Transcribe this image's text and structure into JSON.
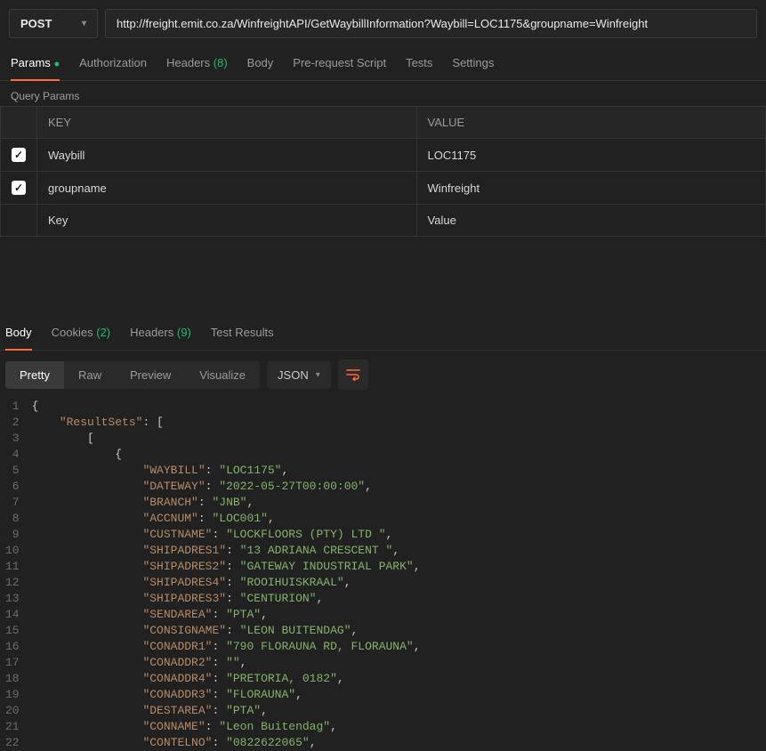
{
  "request": {
    "method": "POST",
    "url": "http://freight.emit.co.za/WinfreightAPI/GetWaybillInformation?Waybill=LOC1175&groupname=Winfreight"
  },
  "tabs": {
    "params": "Params",
    "authorization": "Authorization",
    "headers": "Headers",
    "headers_count": "(8)",
    "body": "Body",
    "prerequest": "Pre-request Script",
    "tests": "Tests",
    "settings": "Settings"
  },
  "query_params": {
    "section_title": "Query Params",
    "key_header": "KEY",
    "value_header": "VALUE",
    "rows": [
      {
        "key": "Waybill",
        "value": "LOC1175"
      },
      {
        "key": "groupname",
        "value": "Winfreight"
      }
    ],
    "placeholder_key": "Key",
    "placeholder_value": "Value"
  },
  "response_tabs": {
    "body": "Body",
    "cookies": "Cookies",
    "cookies_count": "(2)",
    "headers": "Headers",
    "headers_count": "(9)",
    "test_results": "Test Results"
  },
  "viewmodes": {
    "pretty": "Pretty",
    "raw": "Raw",
    "preview": "Preview",
    "visualize": "Visualize",
    "format": "JSON"
  },
  "code_lines": [
    {
      "n": 1,
      "indent": 0,
      "type": "brace",
      "text": "{"
    },
    {
      "n": 2,
      "indent": 1,
      "type": "kv_open",
      "key": "ResultSets",
      "after": ": ["
    },
    {
      "n": 3,
      "indent": 2,
      "type": "brace",
      "text": "["
    },
    {
      "n": 4,
      "indent": 3,
      "type": "brace",
      "text": "{"
    },
    {
      "n": 5,
      "indent": 4,
      "type": "kv",
      "key": "WAYBILL",
      "val": "LOC1175"
    },
    {
      "n": 6,
      "indent": 4,
      "type": "kv",
      "key": "DATEWAY",
      "val": "2022-05-27T00:00:00"
    },
    {
      "n": 7,
      "indent": 4,
      "type": "kv",
      "key": "BRANCH",
      "val": "JNB"
    },
    {
      "n": 8,
      "indent": 4,
      "type": "kv",
      "key": "ACCNUM",
      "val": "LOC001"
    },
    {
      "n": 9,
      "indent": 4,
      "type": "kv",
      "key": "CUSTNAME",
      "val": "LOCKFLOORS (PTY) LTD "
    },
    {
      "n": 10,
      "indent": 4,
      "type": "kv",
      "key": "SHIPADRES1",
      "val": "13 ADRIANA CRESCENT "
    },
    {
      "n": 11,
      "indent": 4,
      "type": "kv",
      "key": "SHIPADRES2",
      "val": "GATEWAY INDUSTRIAL PARK"
    },
    {
      "n": 12,
      "indent": 4,
      "type": "kv",
      "key": "SHIPADRES4",
      "val": "ROOIHUISKRAAL"
    },
    {
      "n": 13,
      "indent": 4,
      "type": "kv",
      "key": "SHIPADRES3",
      "val": "CENTURION"
    },
    {
      "n": 14,
      "indent": 4,
      "type": "kv",
      "key": "SENDAREA",
      "val": "PTA"
    },
    {
      "n": 15,
      "indent": 4,
      "type": "kv",
      "key": "CONSIGNAME",
      "val": "LEON BUITENDAG"
    },
    {
      "n": 16,
      "indent": 4,
      "type": "kv",
      "key": "CONADDR1",
      "val": "790 FLORAUNA RD, FLORAUNA"
    },
    {
      "n": 17,
      "indent": 4,
      "type": "kv",
      "key": "CONADDR2",
      "val": ""
    },
    {
      "n": 18,
      "indent": 4,
      "type": "kv",
      "key": "CONADDR4",
      "val": "PRETORIA, 0182"
    },
    {
      "n": 19,
      "indent": 4,
      "type": "kv",
      "key": "CONADDR3",
      "val": "FLORAUNA"
    },
    {
      "n": 20,
      "indent": 4,
      "type": "kv",
      "key": "DESTAREA",
      "val": "PTA"
    },
    {
      "n": 21,
      "indent": 4,
      "type": "kv",
      "key": "CONNAME",
      "val": "Leon Buitendag"
    },
    {
      "n": 22,
      "indent": 4,
      "type": "kv",
      "key": "CONTELNO",
      "val": "0822622065"
    }
  ]
}
